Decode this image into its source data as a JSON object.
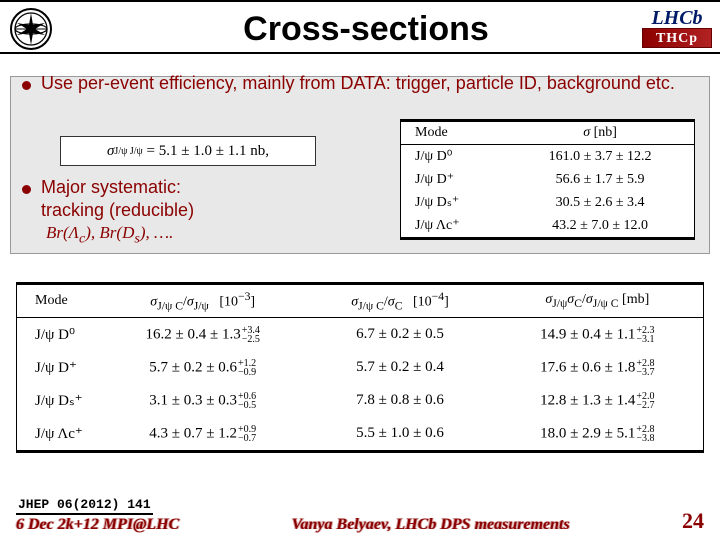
{
  "header": {
    "title": "Cross-sections",
    "logo_right_top": "LHCb",
    "logo_right_bar": "ТНСр"
  },
  "bullets": {
    "b1": "Use per-event efficiency, mainly from DATA: trigger, particle ID, background etc.",
    "b2a": "Major systematic:",
    "b2b": "tracking (reducible)",
    "b2_sub": "Br(Λc), Br(Ds), …."
  },
  "formula": "σJ/ψ J/ψ = 5.1 ± 1.0 ± 1.1 nb,",
  "table1": {
    "h1": "Mode",
    "h2": "σ [nb]",
    "rows": [
      {
        "mode": "J/ψ D⁰",
        "val": "161.0 ± 3.7 ± 12.2"
      },
      {
        "mode": "J/ψ D⁺",
        "val": "56.6 ± 1.7 ± 5.9"
      },
      {
        "mode": "J/ψ Dₛ⁺",
        "val": "30.5 ± 2.6 ± 3.4"
      },
      {
        "mode": "J/ψ Λc⁺",
        "val": "43.2 ± 7.0 ± 12.0"
      }
    ]
  },
  "table2": {
    "h1": "Mode",
    "h2": "σJ/ψ C/σJ/ψ   [10⁻³]",
    "h3": "σJ/ψ C/σC   [10⁻⁴]",
    "h4": "σJ/ψ σC/σJ/ψ C [mb]",
    "rows": [
      {
        "mode": "J/ψ D⁰",
        "c1": "16.2 ± 0.4 ± 1.3",
        "c1a": "+3.4|−2.5",
        "c2": "6.7 ± 0.2 ± 0.5",
        "c3": "14.9 ± 0.4 ± 1.1",
        "c3a": "+2.3|−3.1"
      },
      {
        "mode": "J/ψ D⁺",
        "c1": "5.7 ± 0.2 ± 0.6",
        "c1a": "+1.2|−0.9",
        "c2": "5.7 ± 0.2 ± 0.4",
        "c3": "17.6 ± 0.6 ± 1.8",
        "c3a": "+2.8|−3.7"
      },
      {
        "mode": "J/ψ Dₛ⁺",
        "c1": "3.1 ± 0.3 ± 0.3",
        "c1a": "+0.6|−0.5",
        "c2": "7.8 ± 0.8 ± 0.6",
        "c3": "12.8 ± 1.3 ± 1.4",
        "c3a": "+2.0|−2.7"
      },
      {
        "mode": "J/ψ Λc⁺",
        "c1": "4.3 ± 0.7 ± 1.2",
        "c1a": "+0.9|−0.7",
        "c2": "5.5 ± 1.0 ± 0.6",
        "c3": "18.0 ± 2.9 ± 5.1",
        "c3a": "+2.8|−3.8"
      }
    ]
  },
  "footer": {
    "ref": "JHEP 06(2012) 141",
    "conf": "6 Dec 2k+12  MPI@LHC",
    "author": "Vanya Belyaev, LHCb DPS measurements",
    "page": "24"
  }
}
